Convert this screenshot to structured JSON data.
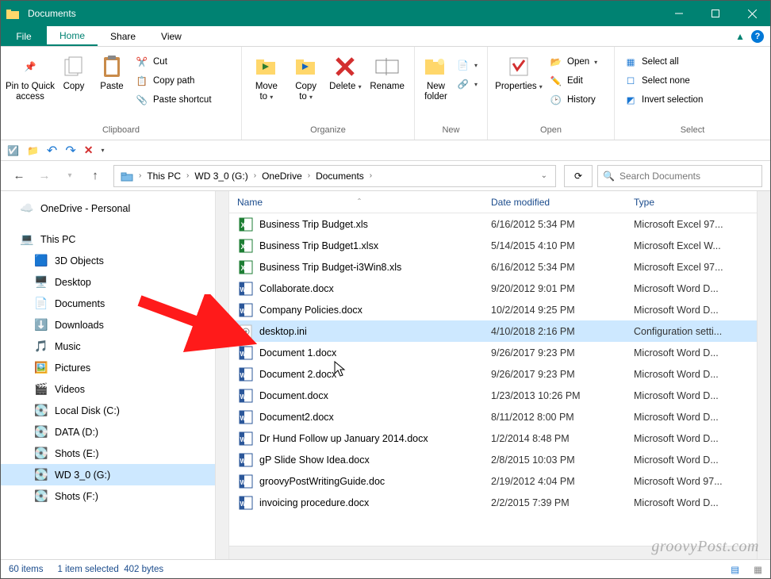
{
  "window": {
    "title": "Documents"
  },
  "tabs": {
    "file": "File",
    "home": "Home",
    "share": "Share",
    "view": "View"
  },
  "ribbon": {
    "clipboard": {
      "label": "Clipboard",
      "pin": "Pin to Quick\naccess",
      "copy": "Copy",
      "paste": "Paste",
      "cut": "Cut",
      "copy_path": "Copy path",
      "paste_shortcut": "Paste shortcut"
    },
    "organize": {
      "label": "Organize",
      "move": "Move\nto",
      "copy": "Copy\nto",
      "delete": "Delete",
      "rename": "Rename"
    },
    "new": {
      "label": "New",
      "new_folder": "New\nfolder"
    },
    "open": {
      "label": "Open",
      "properties": "Properties",
      "open": "Open",
      "edit": "Edit",
      "history": "History"
    },
    "select": {
      "label": "Select",
      "select_all": "Select all",
      "select_none": "Select none",
      "invert": "Invert selection"
    }
  },
  "breadcrumb": [
    "This PC",
    "WD 3_0 (G:)",
    "OneDrive",
    "Documents"
  ],
  "search": {
    "placeholder": "Search Documents"
  },
  "sidebar": {
    "onedrive": "OneDrive - Personal",
    "this_pc": "This PC",
    "items": [
      {
        "label": "3D Objects"
      },
      {
        "label": "Desktop"
      },
      {
        "label": "Documents"
      },
      {
        "label": "Downloads"
      },
      {
        "label": "Music"
      },
      {
        "label": "Pictures"
      },
      {
        "label": "Videos"
      },
      {
        "label": "Local Disk (C:)"
      },
      {
        "label": "DATA (D:)"
      },
      {
        "label": "Shots (E:)"
      },
      {
        "label": "WD 3_0 (G:)"
      },
      {
        "label": "Shots (F:)"
      }
    ]
  },
  "columns": {
    "name": "Name",
    "date": "Date modified",
    "type": "Type"
  },
  "files": [
    {
      "name": "Business Trip Budget.xls",
      "date": "6/16/2012 5:34 PM",
      "type": "Microsoft Excel 97...",
      "icon": "xls"
    },
    {
      "name": "Business Trip Budget1.xlsx",
      "date": "5/14/2015 4:10 PM",
      "type": "Microsoft Excel W...",
      "icon": "xlsx"
    },
    {
      "name": "Business Trip Budget-i3Win8.xls",
      "date": "6/16/2012 5:34 PM",
      "type": "Microsoft Excel 97...",
      "icon": "xls"
    },
    {
      "name": "Collaborate.docx",
      "date": "9/20/2012 9:01 PM",
      "type": "Microsoft Word D...",
      "icon": "docx"
    },
    {
      "name": "Company Policies.docx",
      "date": "10/2/2014 9:25 PM",
      "type": "Microsoft Word D...",
      "icon": "docx"
    },
    {
      "name": "desktop.ini",
      "date": "4/10/2018 2:16 PM",
      "type": "Configuration setti...",
      "icon": "ini",
      "selected": true
    },
    {
      "name": "Document 1.docx",
      "date": "9/26/2017 9:23 PM",
      "type": "Microsoft Word D...",
      "icon": "docx"
    },
    {
      "name": "Document 2.docx",
      "date": "9/26/2017 9:23 PM",
      "type": "Microsoft Word D...",
      "icon": "docx"
    },
    {
      "name": "Document.docx",
      "date": "1/23/2013 10:26 PM",
      "type": "Microsoft Word D...",
      "icon": "docx"
    },
    {
      "name": "Document2.docx",
      "date": "8/11/2012 8:00 PM",
      "type": "Microsoft Word D...",
      "icon": "docx"
    },
    {
      "name": "Dr Hund Follow up January 2014.docx",
      "date": "1/2/2014 8:48 PM",
      "type": "Microsoft Word D...",
      "icon": "docx"
    },
    {
      "name": "gP Slide Show Idea.docx",
      "date": "2/8/2015 10:03 PM",
      "type": "Microsoft Word D...",
      "icon": "docx"
    },
    {
      "name": "groovyPostWritingGuide.doc",
      "date": "2/19/2012 4:04 PM",
      "type": "Microsoft Word 97...",
      "icon": "doc"
    },
    {
      "name": "invoicing procedure.docx",
      "date": "2/2/2015 7:39 PM",
      "type": "Microsoft Word D...",
      "icon": "docx"
    }
  ],
  "status": {
    "count": "60 items",
    "selected": "1 item selected",
    "size": "402 bytes"
  },
  "watermark": "groovyPost.com"
}
